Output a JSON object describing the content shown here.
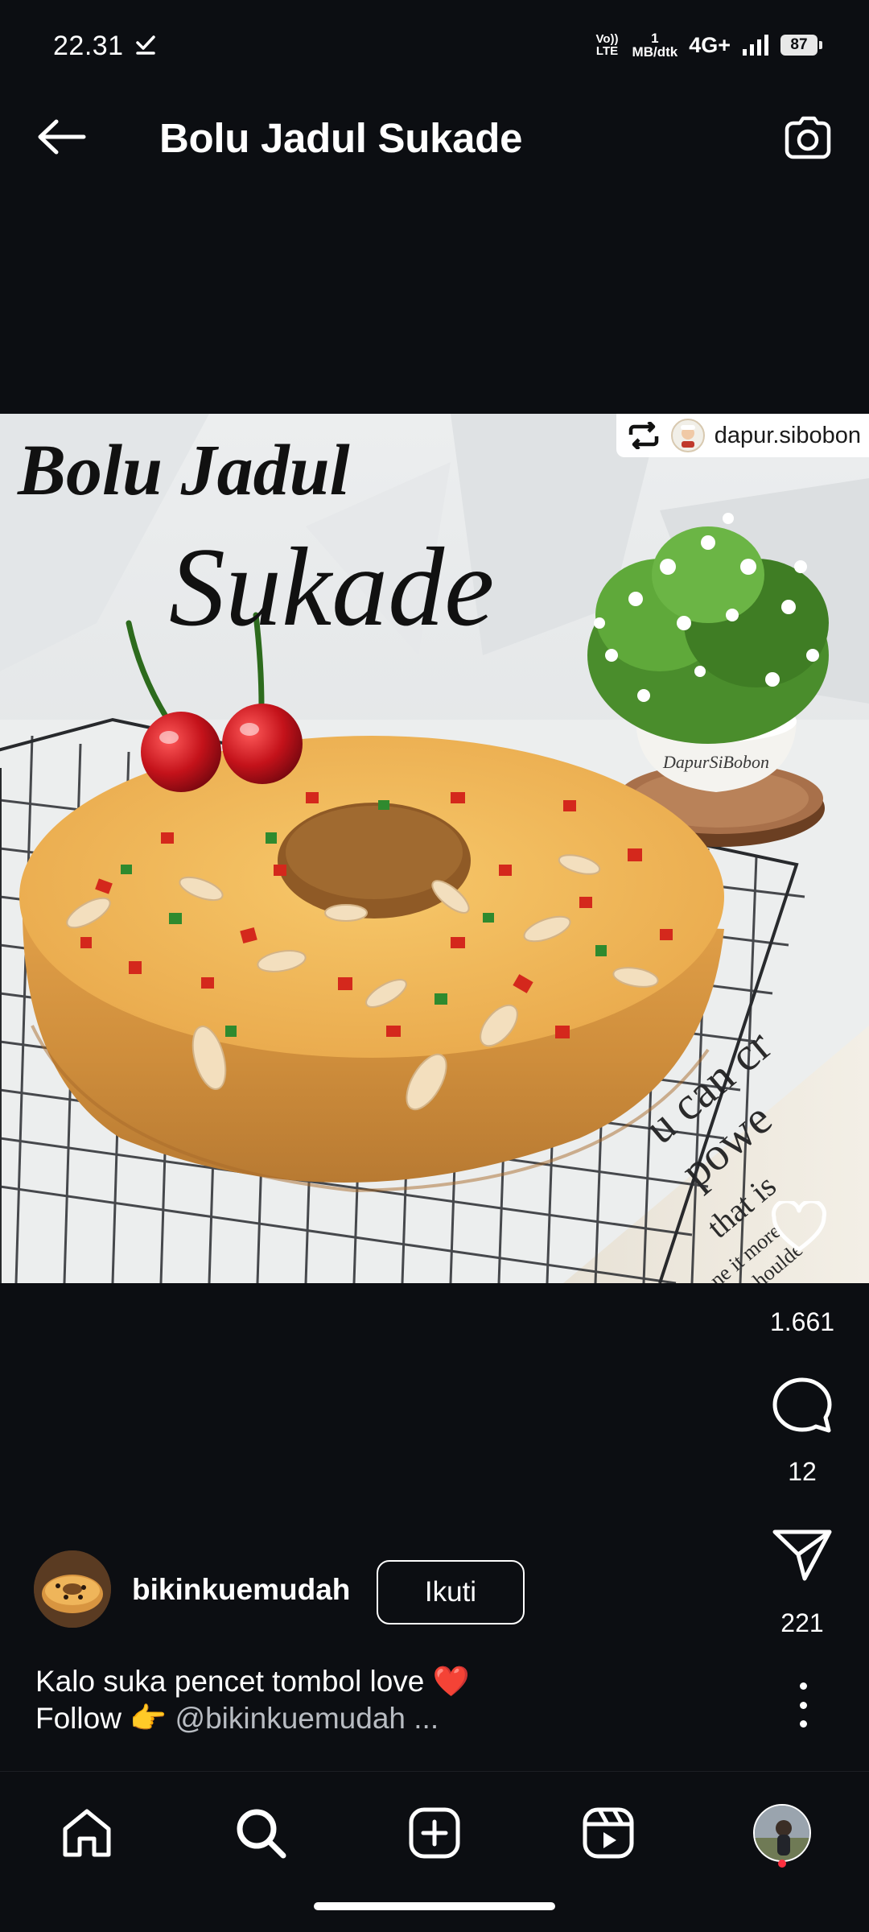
{
  "status_bar": {
    "time": "22.31",
    "volte_top": "Vo))",
    "volte_bottom": "LTE",
    "speed_value": "1",
    "speed_unit": "MB/dtk",
    "network": "4G+",
    "battery": "87"
  },
  "header": {
    "title": "Bolu Jadul Sukade"
  },
  "post": {
    "image_title_line1": "Bolu Jadul",
    "image_title_line2": "Sukade",
    "pot_label": "DapurSiBobon",
    "repost_handle": "dapur.sibobon",
    "newsprint_lines": [
      "u can cr",
      "powe",
      "that is",
      "ne it more",
      "uo the houlde"
    ]
  },
  "actions": {
    "likes": "1.661",
    "comments": "12",
    "shares": "221"
  },
  "author": {
    "username": "bikinkuemudah",
    "follow_label": "Ikuti"
  },
  "caption": {
    "line1": "Kalo suka pencet tombol love ❤️",
    "line2_prefix": "Follow 👉 ",
    "line2_mention": "@bikinkuemudah ..."
  },
  "icons": {
    "back": "arrow-left-icon",
    "camera": "camera-icon",
    "like": "heart-icon",
    "comment": "comment-bubble-icon",
    "share": "paper-plane-icon",
    "more": "more-vertical-icon",
    "nav": [
      "home-icon",
      "search-icon",
      "create-post-icon",
      "reels-icon",
      "profile-avatar"
    ]
  },
  "colors": {
    "background": "#0c0e12",
    "text": "#ffffff",
    "notification_dot": "#ff3040"
  }
}
